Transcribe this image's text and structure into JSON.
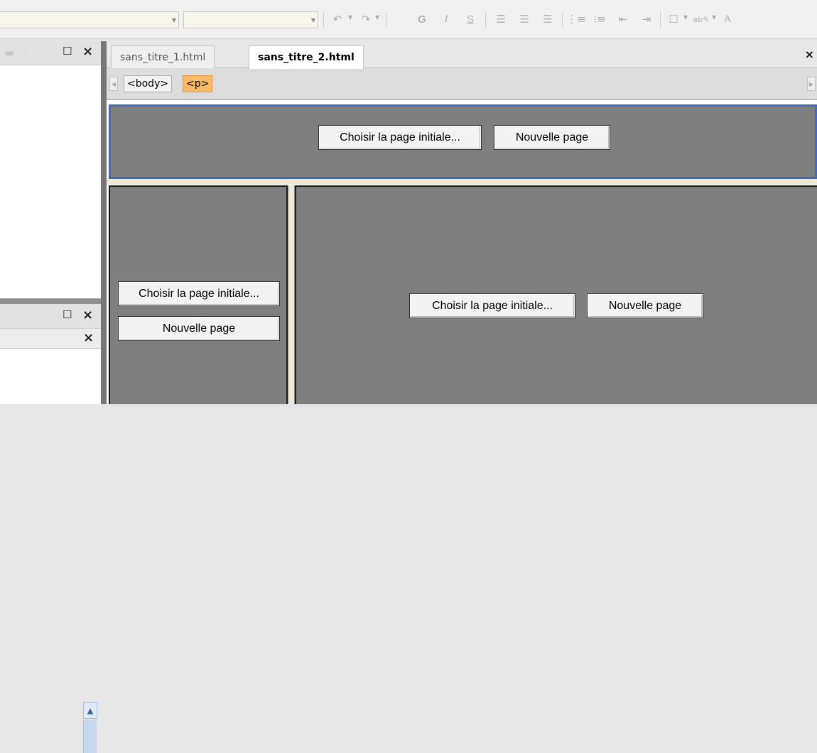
{
  "toolbar": {
    "combo_font": "",
    "combo_size": "",
    "icons": {
      "undo": "undo-icon",
      "redo": "redo-icon",
      "bold": "G",
      "italic": "I",
      "underline": "S",
      "align_left": "align-left-icon",
      "align_center": "align-center-icon",
      "align_right": "align-right-icon",
      "list_numbered": "numbered-list-icon",
      "list_bullets": "bulleted-list-icon",
      "outdent": "outdent-icon",
      "indent": "indent-icon",
      "border": "border-icon",
      "highlight": "highlight-icon",
      "font_color": "A"
    }
  },
  "left_panel": {
    "top_buttons": [
      "folder-icon",
      "page-icon",
      "maximize-icon",
      "close-icon"
    ],
    "bottom_buttons": [
      "maximize-icon",
      "close-icon"
    ],
    "bottom_sub_close": "×",
    "scroll_up": "^"
  },
  "document": {
    "tabs": [
      {
        "label": "sans_titre_1.html",
        "active": false
      },
      {
        "label": "sans_titre_2.html",
        "active": true
      }
    ],
    "close_label": "×",
    "tags": [
      "<body>",
      "<p>"
    ]
  },
  "frames": {
    "top": {
      "choose_label": "Choisir la page initiale...",
      "new_label": "Nouvelle page"
    },
    "left": {
      "choose_label": "Choisir la page initiale...",
      "new_label": "Nouvelle page"
    },
    "main": {
      "choose_label": "Choisir la page initiale...",
      "new_label": "Nouvelle page"
    }
  },
  "colors": {
    "frame_bg": "#7f7f7f",
    "selected_frame_border": "#3d6cc0",
    "selected_tag": "#f7b96a"
  }
}
